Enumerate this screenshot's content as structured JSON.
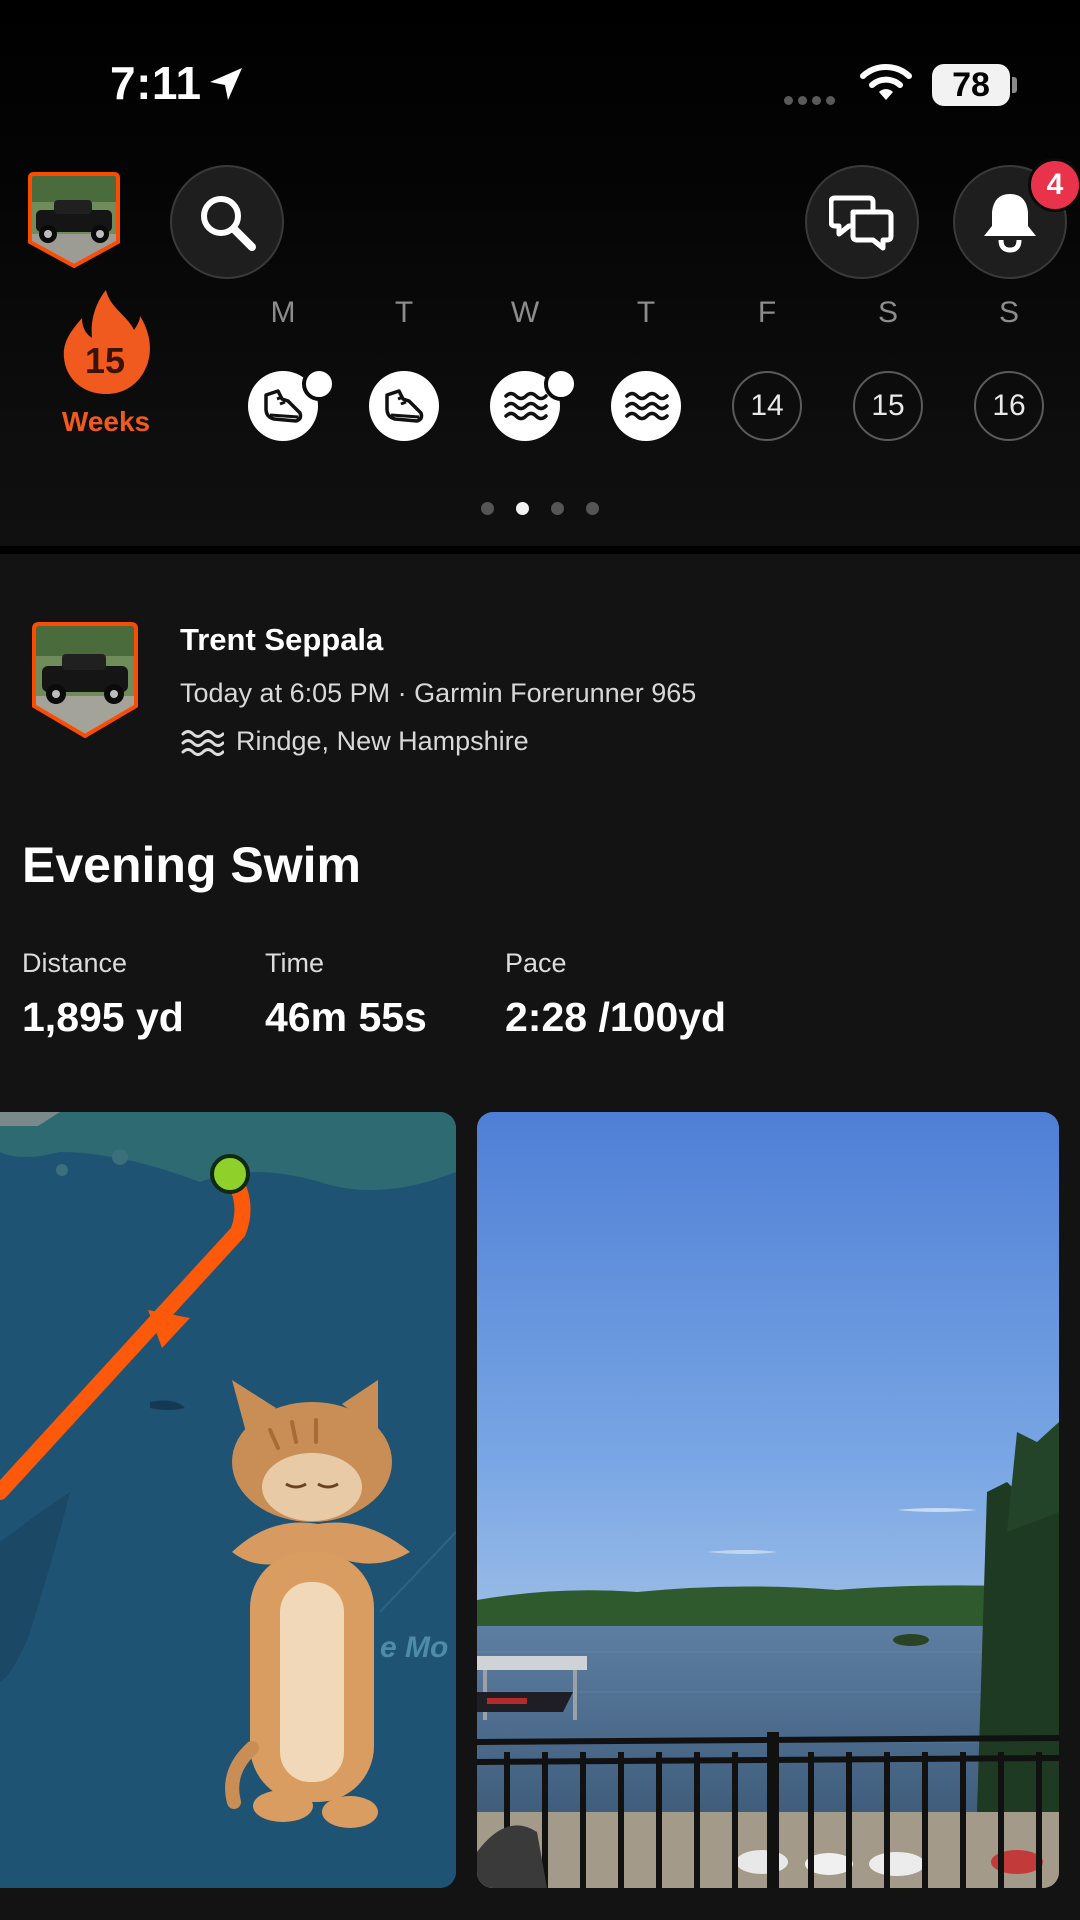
{
  "status_bar": {
    "time": "7:11",
    "battery": "78"
  },
  "header": {
    "notification_count": "4",
    "icons": [
      "search-icon",
      "chat-icon",
      "bell-icon"
    ]
  },
  "streak": {
    "count": "15",
    "label": "Weeks"
  },
  "week": {
    "days": [
      {
        "letter": "M",
        "state": "run",
        "icon": "shoe-icon",
        "dot": true
      },
      {
        "letter": "T",
        "state": "run",
        "icon": "shoe-icon",
        "dot": false
      },
      {
        "letter": "W",
        "state": "swim",
        "icon": "swim-icon",
        "dot": true
      },
      {
        "letter": "T",
        "state": "swim",
        "icon": "swim-icon",
        "dot": false
      },
      {
        "letter": "F",
        "state": "future",
        "date": "14"
      },
      {
        "letter": "S",
        "state": "future",
        "date": "15"
      },
      {
        "letter": "S",
        "state": "future",
        "date": "16"
      }
    ],
    "pager_active_index": 1,
    "pager_count": 4
  },
  "activity": {
    "athlete_name": "Trent Seppala",
    "meta": "Today at 6:05 PM · Garmin Forerunner 965",
    "location": "Rindge, New Hampshire",
    "title": "Evening Swim",
    "stats": [
      {
        "label": "Distance",
        "value": "1,895 yd"
      },
      {
        "label": "Time",
        "value": "46m 55s"
      },
      {
        "label": "Pace",
        "value": "2:28 /100yd"
      }
    ],
    "map_label_fragment": "e Mo"
  },
  "colors": {
    "accent": "#fc4c02",
    "streak": "#f05a1e",
    "badge": "#e8334a",
    "map_water": "#1f5373",
    "route": "#fc5a0a",
    "start_marker": "#8fd12a"
  }
}
